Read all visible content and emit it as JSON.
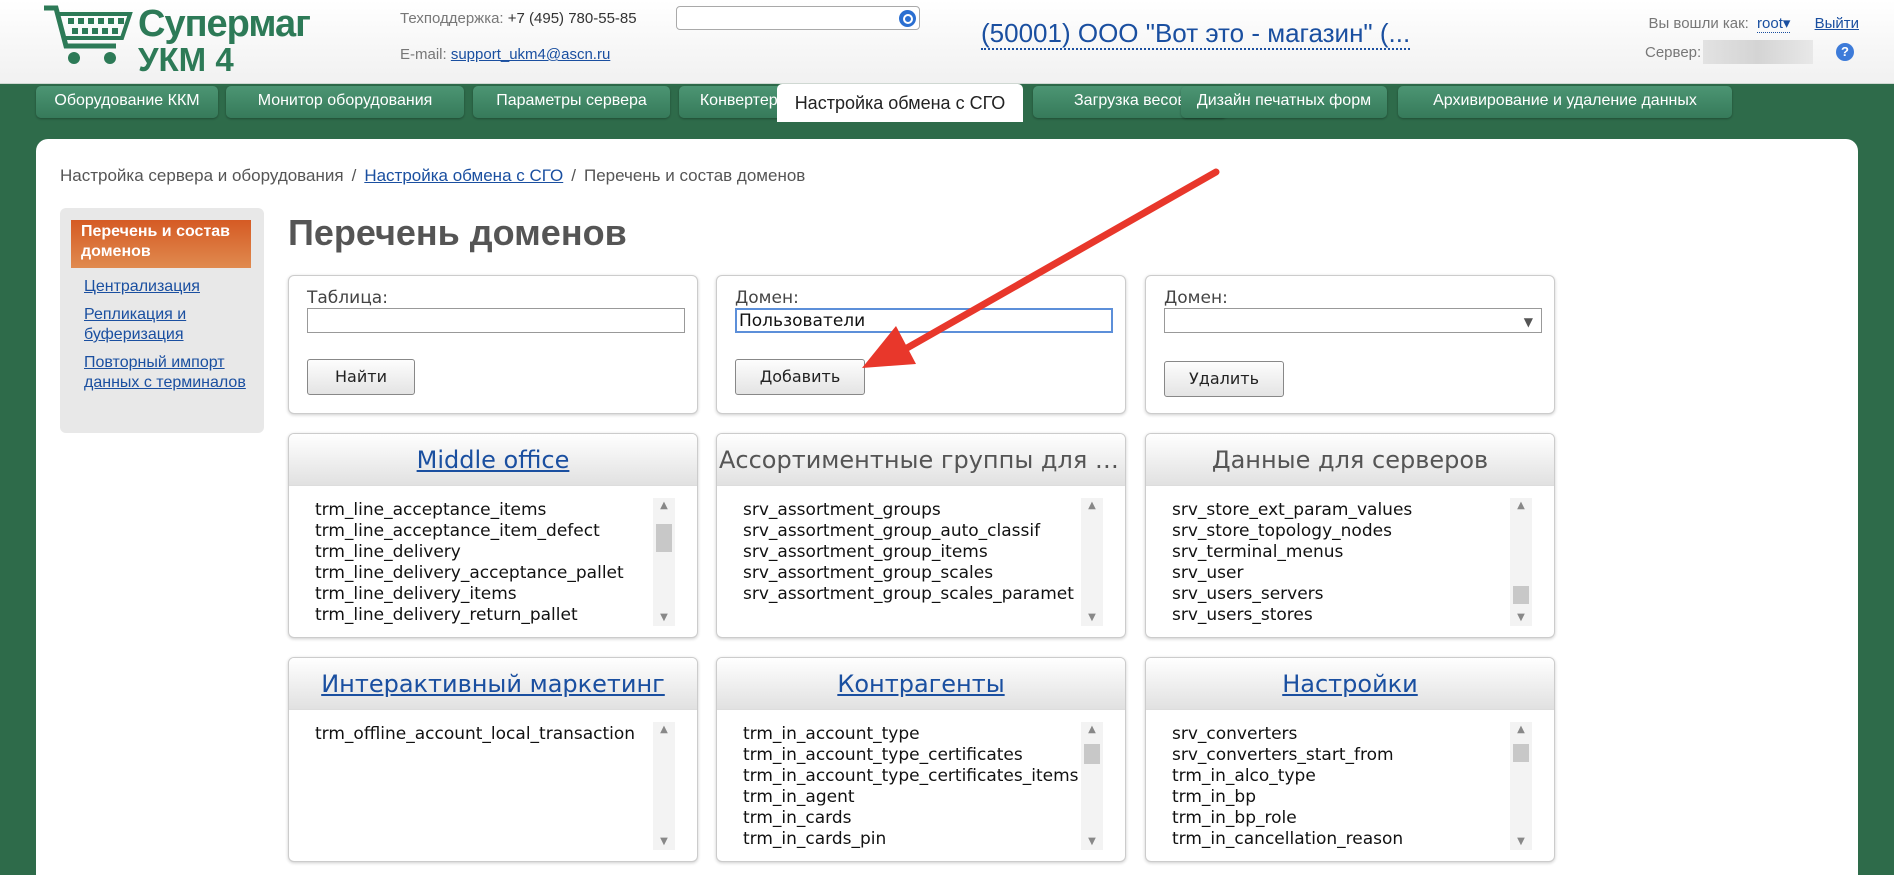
{
  "header": {
    "logo_line1": "Супермаг",
    "logo_line2": "УКМ 4",
    "support_label": "Техподдержка:",
    "support_phone": "+7 (495) 780-55-85",
    "email_label": "E-mail:",
    "email_value": "support_ukm4@ascn.ru",
    "search_placeholder": "",
    "company": "(50001) ООО \"Вот это - магазин\" (...",
    "logged_in_label": "Вы вошли как:",
    "user": "root",
    "user_caret": "▾",
    "logout": "Выйти",
    "server_label": "Сервер:",
    "help": "?"
  },
  "tabs": [
    {
      "label": "Оборудование ККМ"
    },
    {
      "label": "Монитор оборудования"
    },
    {
      "label": "Параметры сервера"
    },
    {
      "label": "Конвертеры"
    },
    {
      "label": "Настройка обмена с СГО"
    },
    {
      "label": "Загрузка весов"
    },
    {
      "label": "Дизайн печатных форм"
    },
    {
      "label": "Архивирование и удаление данных"
    }
  ],
  "breadcrumb": {
    "item1": "Настройка сервера и оборудования",
    "sep": "/",
    "item2": "Настройка обмена с СГО",
    "item3": "Перечень и состав доменов"
  },
  "sidebar": {
    "active": "Перечень и состав доменов",
    "links": [
      "Централизация",
      "Репликация и буферизация",
      "Повторный импорт данных с терминалов"
    ]
  },
  "page_title": "Перечень доменов",
  "controls": {
    "table_label": "Таблица:",
    "table_value": "",
    "find_button": "Найти",
    "domain_label": "Домен:",
    "domain_value": "Пользователи",
    "add_button": "Добавить",
    "domain2_label": "Домен:",
    "domain2_value": "",
    "delete_button": "Удалить"
  },
  "domains": [
    {
      "title": "Middle office",
      "link": true,
      "items": [
        "trm_line_acceptance_items",
        "trm_line_acceptance_item_defect",
        "trm_line_delivery",
        "trm_line_delivery_acceptance_pallet",
        "trm_line_delivery_items",
        "trm_line_delivery_return_pallet"
      ]
    },
    {
      "title": "Ассортиментные группы для в...",
      "link": false,
      "items": [
        "srv_assortment_groups",
        "srv_assortment_group_auto_classif",
        "srv_assortment_group_items",
        "srv_assortment_group_scales",
        "srv_assortment_group_scales_paramet"
      ]
    },
    {
      "title": "Данные для серверов",
      "link": false,
      "items": [
        "srv_store_ext_param_values",
        "srv_store_topology_nodes",
        "srv_terminal_menus",
        "srv_user",
        "srv_users_servers",
        "srv_users_stores"
      ]
    },
    {
      "title": "Интерактивный маркетинг",
      "link": true,
      "items": [
        "trm_offline_account_local_transaction"
      ]
    },
    {
      "title": "Контрагенты",
      "link": true,
      "items": [
        "trm_in_account_type",
        "trm_in_account_type_certificates",
        "trm_in_account_type_certificates_items",
        "trm_in_agent",
        "trm_in_cards",
        "trm_in_cards_pin"
      ]
    },
    {
      "title": "Настройки",
      "link": true,
      "items": [
        "srv_converters",
        "srv_converters_start_from",
        "trm_in_alco_type",
        "trm_in_bp",
        "trm_in_bp_role",
        "trm_in_cancellation_reason"
      ]
    }
  ],
  "icons": {
    "search": "search-icon",
    "help": "help-icon",
    "cart": "cart-icon",
    "scroll_up": "▲",
    "scroll_down": "▼",
    "select_arrow": "▼"
  },
  "colors": {
    "brand_green": "#2d7a57",
    "background_green": "#2e6b4a",
    "tab_green": "#3f8866",
    "link_blue": "#1a4fa0",
    "sidebar_active": "#d9652e",
    "annotation_red": "#e8372b"
  }
}
